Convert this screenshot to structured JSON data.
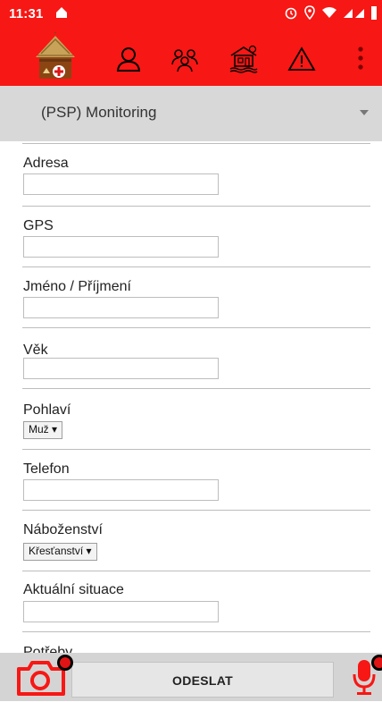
{
  "status_bar": {
    "time": "11:31"
  },
  "dropdown": {
    "selected": "(PSP) Monitoring"
  },
  "form": {
    "fields": [
      {
        "label": "Adresa"
      },
      {
        "label": "GPS"
      },
      {
        "label": "Jméno / Příjmení"
      },
      {
        "label": "Věk"
      },
      {
        "label": "Pohlaví",
        "select_value": "Muž ▾"
      },
      {
        "label": "Telefon"
      },
      {
        "label": "Náboženství",
        "select_value": "Křesťanství ▾"
      },
      {
        "label": "Aktuální situace"
      },
      {
        "label": "Potřeby"
      }
    ]
  },
  "bottom": {
    "send_label": "ODESLAT"
  },
  "colors": {
    "accent": "#f71714",
    "badge": "#e01414"
  }
}
